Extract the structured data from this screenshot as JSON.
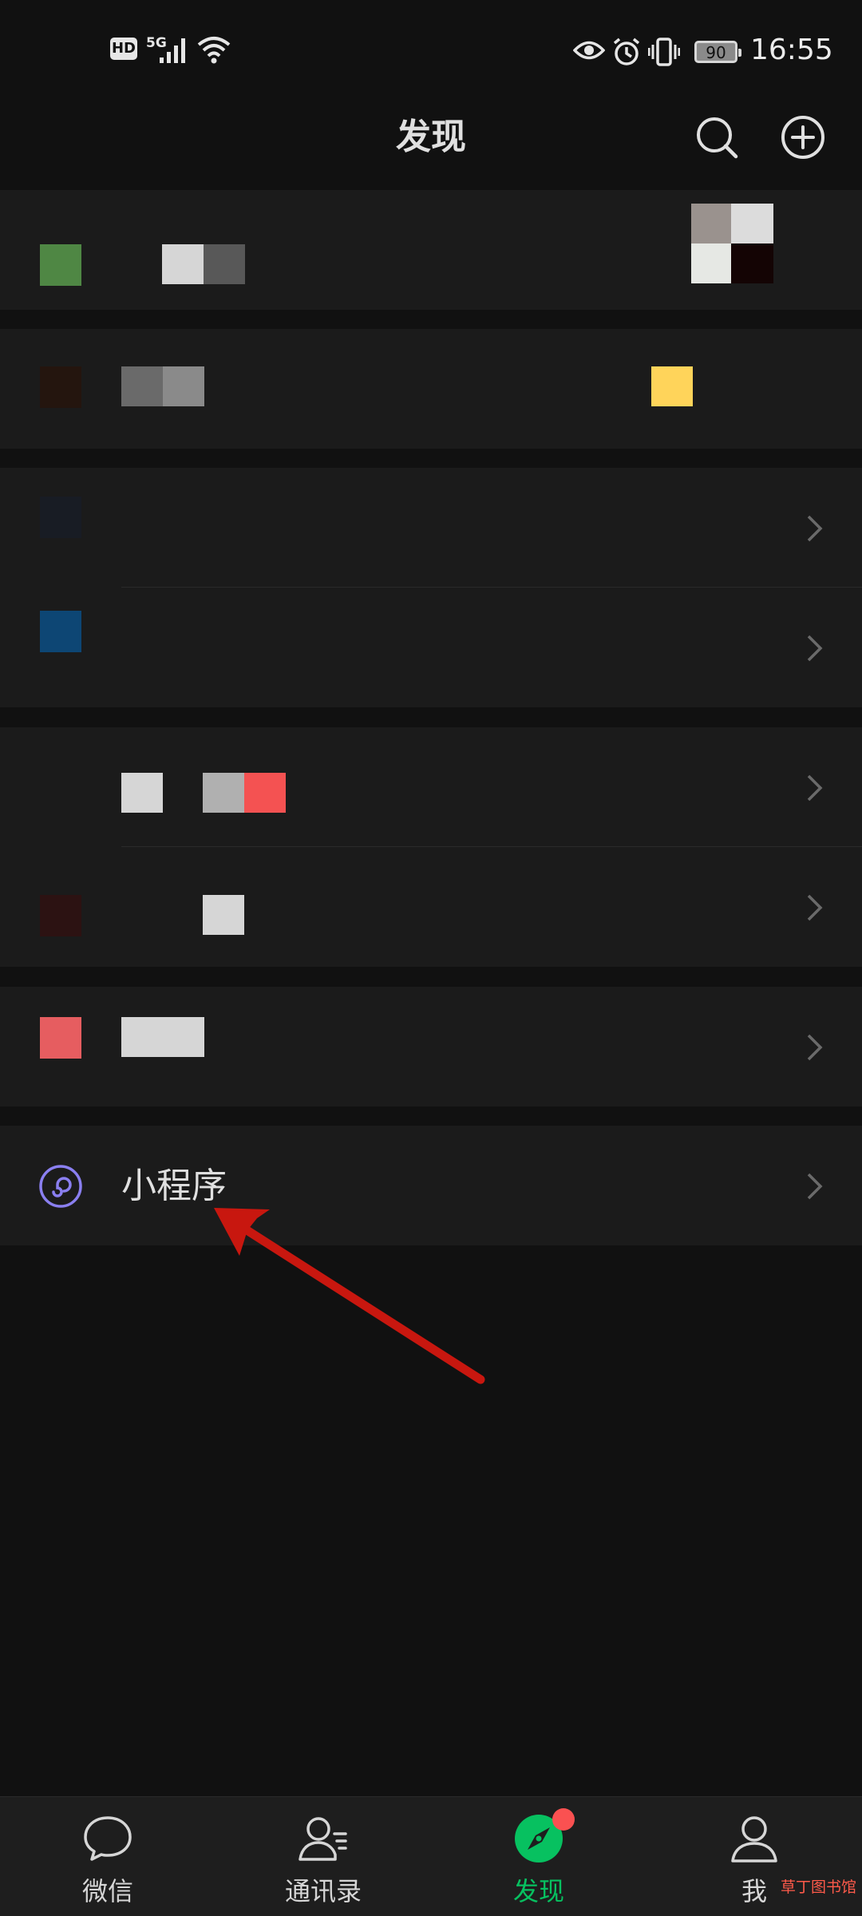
{
  "status_bar": {
    "hd_label": "HD",
    "network_label": "5G",
    "battery_level": "90",
    "time": "16:55"
  },
  "header": {
    "title": "发现",
    "icons": [
      "search-icon",
      "add-icon"
    ]
  },
  "list": {
    "mini_programs_label": "小程序"
  },
  "tabbar": {
    "tabs": [
      {
        "label": "微信",
        "icon": "chat-icon",
        "active": false
      },
      {
        "label": "通讯录",
        "icon": "contacts-icon",
        "active": false
      },
      {
        "label": "发现",
        "icon": "compass-icon",
        "active": true
      },
      {
        "label": "我",
        "icon": "person-icon",
        "active": false
      }
    ]
  },
  "watermark": "草丁图书馆",
  "colors": {
    "accent": "#07c160",
    "badge": "#fa5151",
    "mini_program_icon": "#8a7ff0",
    "annotation_arrow": "#c8170f"
  }
}
